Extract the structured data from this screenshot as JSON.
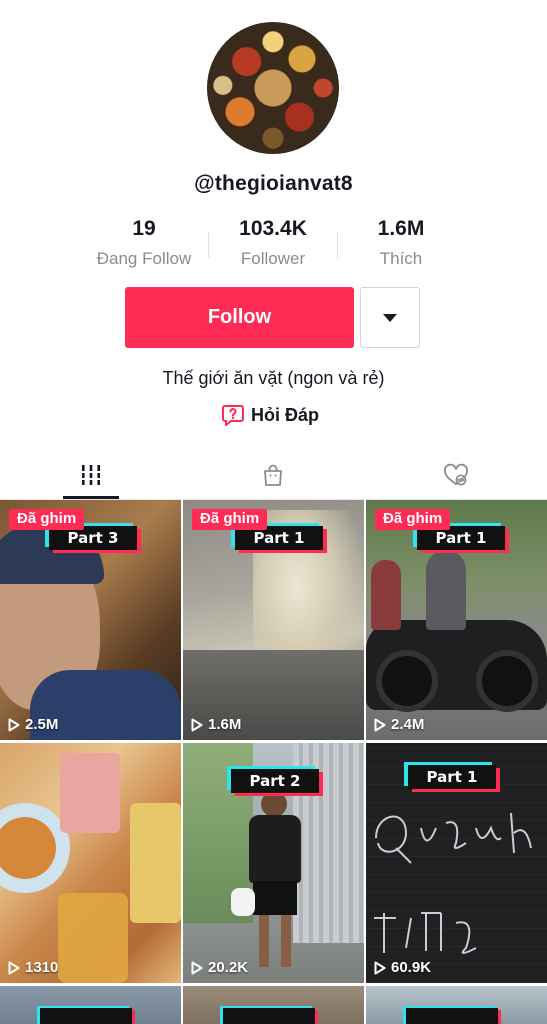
{
  "profile": {
    "username": "@thegioianvat8",
    "bio": "Thế giới ăn vặt (ngon và rẻ)",
    "qa_label": "Hỏi Đáp"
  },
  "stats": [
    {
      "value": "19",
      "label": "Đang Follow"
    },
    {
      "value": "103.4K",
      "label": "Follower"
    },
    {
      "value": "1.6M",
      "label": "Thích"
    }
  ],
  "actions": {
    "follow_label": "Follow"
  },
  "tabs": [
    {
      "name": "videos",
      "icon": "grid-icon",
      "active": true
    },
    {
      "name": "shop",
      "icon": "shopping-bag-icon",
      "active": false
    },
    {
      "name": "liked",
      "icon": "hidden-heart-icon",
      "active": false
    }
  ],
  "colors": {
    "accent": "#fe2c55",
    "badge_cyan": "#2fe3ec"
  },
  "videos": [
    {
      "pinned_label": "Đã ghim",
      "part": "Part 3",
      "views": "2.5M"
    },
    {
      "pinned_label": "Đã ghim",
      "part": "Part 1",
      "views": "1.6M"
    },
    {
      "pinned_label": "Đã ghim",
      "part": "Part 1",
      "views": "2.4M"
    },
    {
      "pinned_label": "",
      "part": "",
      "views": "1310"
    },
    {
      "pinned_label": "",
      "part": "Part 2",
      "views": "20.2K"
    },
    {
      "pinned_label": "",
      "part": "Part 1",
      "views": "60.9K"
    }
  ]
}
